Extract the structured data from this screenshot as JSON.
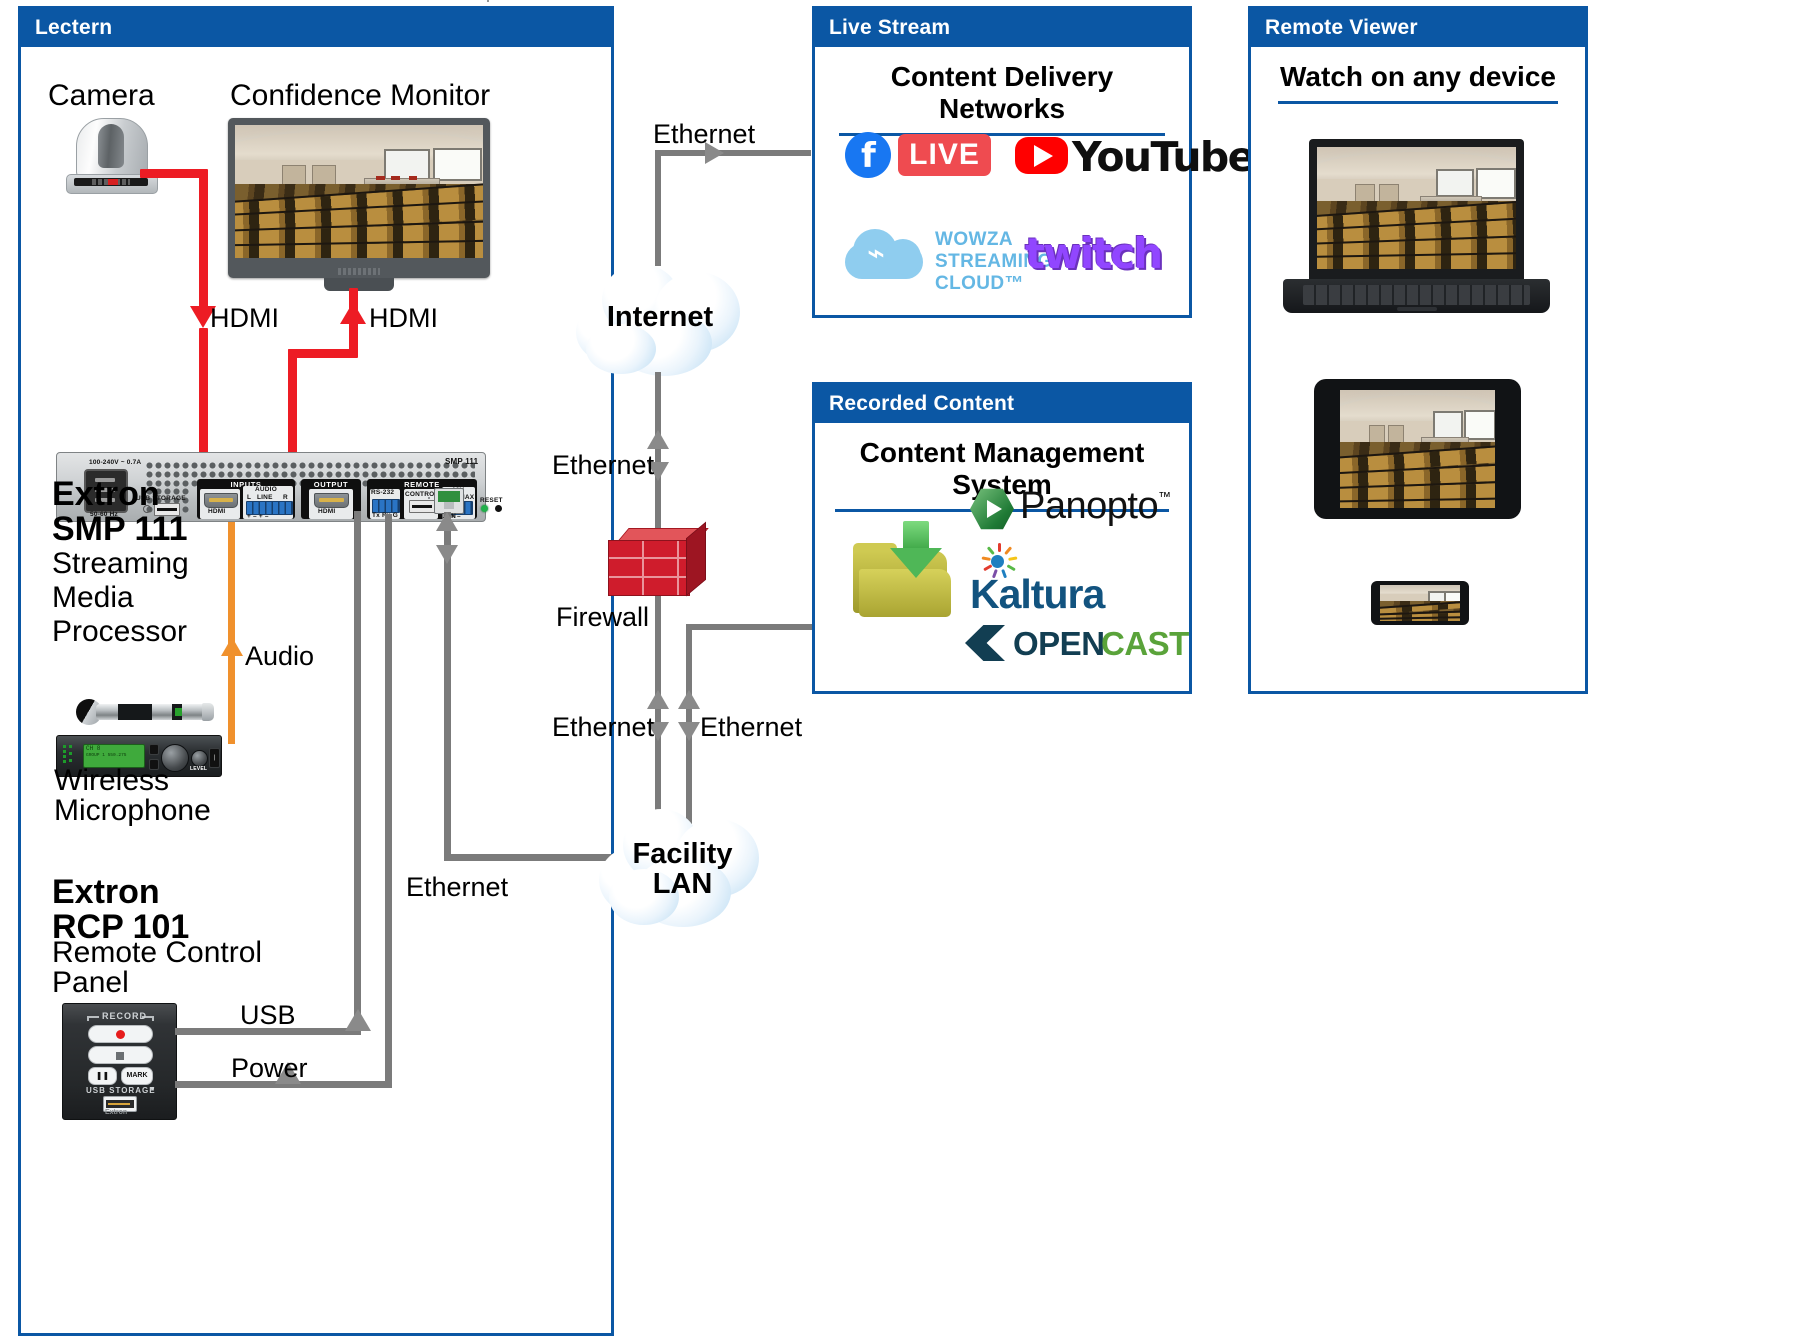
{
  "panels": {
    "lectern": {
      "title": "Lectern"
    },
    "live_stream": {
      "title": "Live Stream",
      "subtitle": "Content Delivery Networks"
    },
    "recorded": {
      "title": "Recorded Content",
      "subtitle": "Content Management System"
    },
    "remote_viewer": {
      "title": "Remote  Viewer",
      "subtitle": "Watch on any device"
    }
  },
  "lectern": {
    "camera_label": "Camera",
    "monitor_label": "Confidence Monitor",
    "hdmi_camera": "HDMI",
    "hdmi_monitor": "HDMI",
    "audio_label": "Audio",
    "usb_label": "USB",
    "power_label": "Power",
    "ethernet_label": "Ethernet",
    "smp": {
      "brand": "Extron",
      "model": "SMP 111",
      "desc_line1": "Streaming",
      "desc_line2": "Media",
      "desc_line3": "Processor",
      "badge": "SMP 111",
      "power_rating": "100-240V ~ 0.7A",
      "power_hz": "50-60 Hz",
      "usb_storage": "USB STORAGE",
      "inputs": "INPUTS",
      "output": "OUTPUT",
      "remote": "REMOTE",
      "audio": "AUDIO",
      "audio_l": "L",
      "audio_line": "LINE",
      "audio_r": "R",
      "audio_pol": "+  –      +  –",
      "hdmi_in": "HDMI",
      "hdmi_out": "HDMI",
      "rs232": "RS-232",
      "rs232_pins": "Tx Rx G",
      "control": "CONTROL",
      "power12v": "+12V",
      "power12v_max": "1.0A MAX",
      "power12v_pol": "+  –",
      "reset": "RESET",
      "lan": "LAN"
    },
    "mic": {
      "label_line1": "Wireless",
      "label_line2": "Microphone",
      "lcd_line1": "CH 8",
      "lcd_line2": "GROUP 1  550.275",
      "level": "LEVEL"
    },
    "rcp": {
      "brand": "Extron",
      "model": "RCP 101",
      "desc_line1": "Remote Control",
      "desc_line2": "Panel",
      "record": "RECORD",
      "mark": "MARK",
      "usb_storage": "USB STORAGE",
      "logo": "Extron"
    }
  },
  "network": {
    "internet": "Internet",
    "facility_lan_line1": "Facility",
    "facility_lan_line2": "LAN",
    "firewall": "Firewall",
    "eth_top": "Ethernet",
    "eth_internet_firewall": "Ethernet",
    "eth_lan_left": "Ethernet",
    "eth_lan_right": "Ethernet",
    "eth_smp": "Ethernet"
  },
  "cdn_logos": [
    {
      "name": "facebook-live",
      "mark": "f",
      "text": "LIVE"
    },
    {
      "name": "youtube",
      "text": "YouTube"
    },
    {
      "name": "wowza-streaming-cloud",
      "line1": "WOWZA",
      "line2": "STREAMING",
      "line3": "CLOUD™"
    },
    {
      "name": "twitch",
      "text": "twitch"
    }
  ],
  "cms_logos": [
    {
      "name": "panopto",
      "text": "Panopto",
      "tm": "™"
    },
    {
      "name": "kaltura",
      "text": "Kaltura"
    },
    {
      "name": "opencast",
      "text_a": "OPEN",
      "text_b": "CAST"
    },
    {
      "name": "download-folder"
    }
  ],
  "remote_devices": [
    {
      "name": "laptop"
    },
    {
      "name": "tablet"
    },
    {
      "name": "smartphone"
    }
  ],
  "colors": {
    "brand_blue": "#0b57a4",
    "wire_gray": "#7b7b7b",
    "wire_red": "#ed1c24",
    "wire_orange": "#f0912d",
    "firewall_red": "#cf1c2c",
    "facebook_blue": "#1877f2",
    "live_red": "#ef4b50",
    "youtube_red": "#ff0000",
    "wowza_blue": "#64b7e4",
    "twitch_purple": "#9146ff",
    "panopto_green": "#1f7a35",
    "kaltura_blue": "#12537f",
    "opencast_dark": "#123e52",
    "opencast_green": "#5aa33a"
  }
}
